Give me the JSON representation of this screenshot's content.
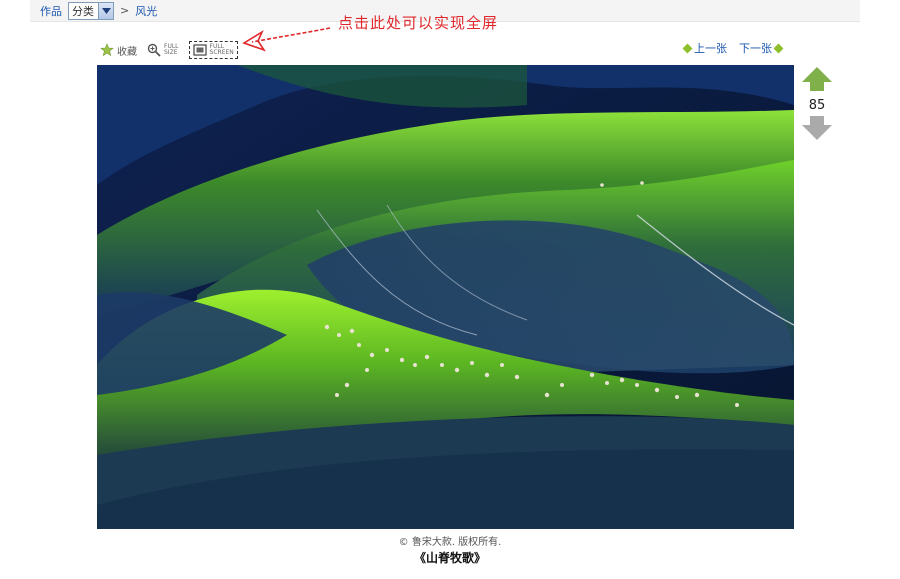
{
  "breadcrumb": {
    "works_label": "作品",
    "category_select": "分类",
    "separator": ">",
    "current": "风光"
  },
  "tools": {
    "favorite_label": "收藏",
    "full_size_label_1": "FULL",
    "full_size_label_2": "SIZE",
    "full_screen_label_1": "FULL",
    "full_screen_label_2": "SCREEN"
  },
  "annotation": {
    "text": "点击此处可以实现全屏",
    "color": "#e0282a"
  },
  "pager": {
    "prev_label": "上一张",
    "next_label": "下一张"
  },
  "vote": {
    "count": "85",
    "up_color": "#7fb04a",
    "down_color": "#aaaaaa"
  },
  "photo": {
    "copyright": "© 鲁宋大款. 版权所有.",
    "caption": "《山脊牧歌》"
  },
  "colors": {
    "link": "#1a56b0",
    "accent_green": "#8fbf2a"
  }
}
